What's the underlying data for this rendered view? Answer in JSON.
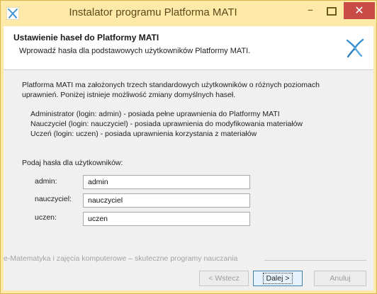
{
  "window": {
    "title": "Instalator programu Platforma MATI",
    "minimize_label": "–",
    "close_label": "✕"
  },
  "header": {
    "title": "Ustawienie haseł do Platformy MATI",
    "subtitle": "Wprowadź hasła dla podstawowych użytkowników Platformy MATI."
  },
  "intro": {
    "text": "Platforma MATI ma założonych trzech standardowych użytkowników o różnych poziomach uprawnień. Poniżej istnieje możliwość zmiany domyślnych haseł."
  },
  "roles": [
    "Administrator (login: admin) - posiada pełne uprawnienia do Platformy MATI",
    "Nauczyciel (login: nauczyciel) - posiada uprawnienia do modyfikowania materiałów",
    "Uczeń (login: uczen) - posiada uprawnienia korzystania z materiałów"
  ],
  "prompt": "Podaj hasła dla użytkowników:",
  "fields": [
    {
      "label": "admin:",
      "value": "admin"
    },
    {
      "label": "nauczyciel:",
      "value": "nauczyciel"
    },
    {
      "label": "uczen:",
      "value": "uczen"
    }
  ],
  "footer": {
    "branding": "e-Matematyka i zajęcia komputerowe – skuteczne programy nauczania"
  },
  "buttons": {
    "back_label": "< Wstecz",
    "next_label": "Dalej >",
    "cancel_label": "Anuluj"
  },
  "colors": {
    "titlebar": "#ffe9a8",
    "close": "#c94b45",
    "logo": "#3a8fd0"
  },
  "icons": {
    "app": "mati-star-icon",
    "header_logo": "mati-logo-icon"
  }
}
